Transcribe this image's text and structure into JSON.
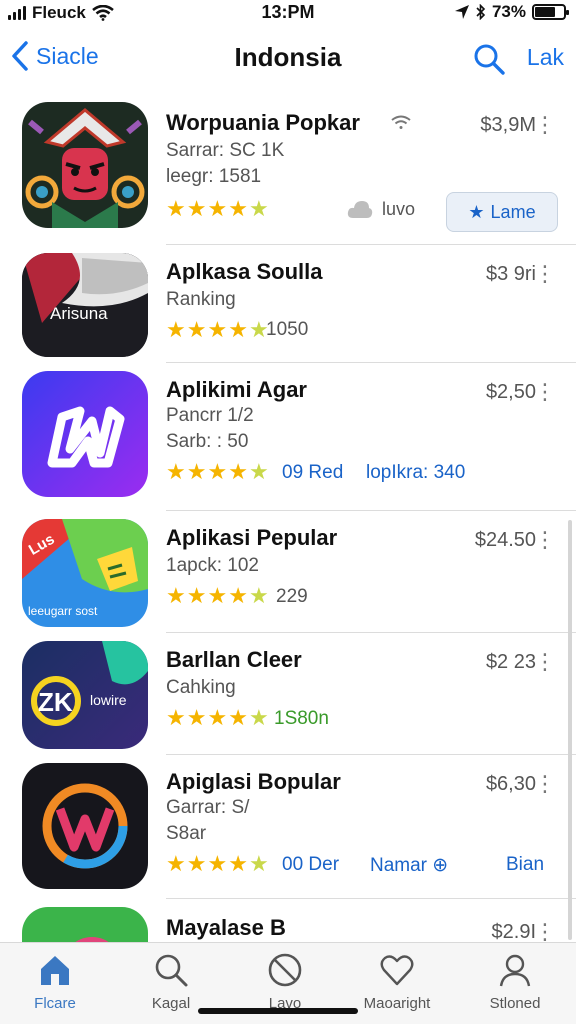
{
  "status": {
    "carrier": "Fleuck",
    "time": "13:PM",
    "battery": "73%",
    "battery_level": 0.73
  },
  "nav": {
    "back_label": "Siacle",
    "title": "Indonsia",
    "edit_label": "Lak"
  },
  "apps": [
    {
      "name": "Worpuania Popkar",
      "sub1": "Sarrar: SC 1K",
      "sub2": "leegr: 1581",
      "price": "$3,9M",
      "rating": 4.5,
      "get_label": "Lame",
      "cloud_label": "luvo"
    },
    {
      "name": "Aplkasa Soulla",
      "sub1": "Ranking",
      "price": "$3 9ri",
      "rating": 4.5,
      "stat1": "1050"
    },
    {
      "name": "Aplikimi Agar",
      "sub1": "Pancrr 1/2",
      "sub2": "Sarb: : 50",
      "price": "$2,50",
      "rating": 4.5,
      "stat1": "09 Red",
      "stat2": "lopIkra: 340"
    },
    {
      "name": "Aplikasi Pepular",
      "sub1": "1apck: 102",
      "price": "$24.50",
      "rating": 4.5,
      "stat1": "229"
    },
    {
      "name": "Barllan Cleer",
      "sub1": "Cahking",
      "price": "$2 23",
      "rating": 4.5,
      "stat1": "1S80n"
    },
    {
      "name": "Apiglasi Bopular",
      "sub1": "Garrar: S/",
      "sub2": "S8ar",
      "price": "$6,30",
      "rating": 4.5,
      "stat1": "00 Der",
      "stat2": "Namar",
      "stat3": "Bian"
    },
    {
      "name": "Mayalase B",
      "price": "$2.9I"
    }
  ],
  "icon_text": {
    "app2": "Arisuna",
    "app4_top": "Lus",
    "app4_bottom": "leeugarr sost",
    "app5_letter": "ZK",
    "app5_word": "lowire"
  },
  "tabs": [
    {
      "label": "Flcare",
      "icon": "home-icon"
    },
    {
      "label": "Kagal",
      "icon": "search-icon"
    },
    {
      "label": "Lavo",
      "icon": "no-entry-icon"
    },
    {
      "label": "Maoaright",
      "icon": "heart-icon"
    },
    {
      "label": "Stloned",
      "icon": "person-icon"
    }
  ],
  "colors": {
    "accent": "#1a73e8",
    "star": "#f5b400",
    "green_stat": "#3a9a2a",
    "tab_active": "#3b78c2"
  }
}
